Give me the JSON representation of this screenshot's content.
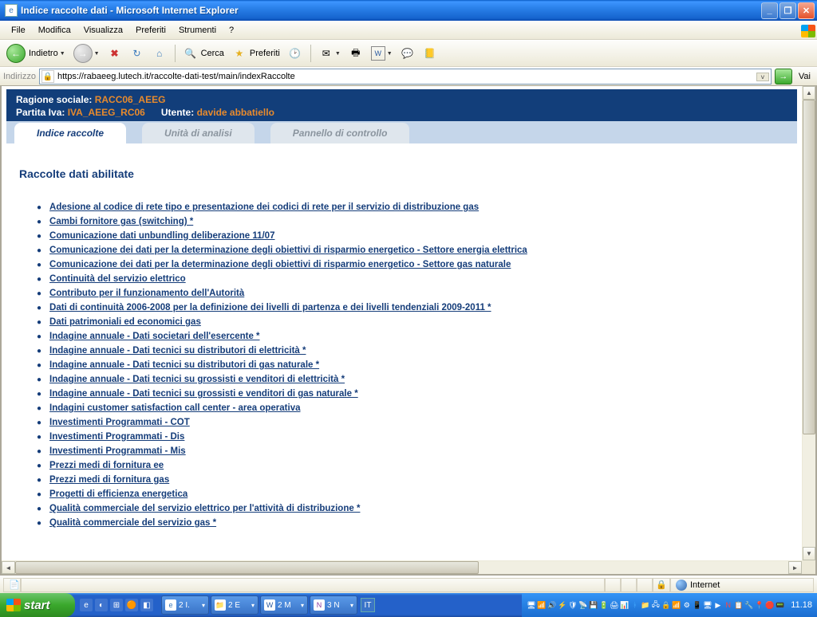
{
  "window": {
    "title": "Indice raccolte dati - Microsoft Internet Explorer"
  },
  "menu": [
    "File",
    "Modifica",
    "Visualizza",
    "Preferiti",
    "Strumenti",
    "?"
  ],
  "toolbar": {
    "back": "Indietro",
    "search": "Cerca",
    "favorites": "Preferiti"
  },
  "address": {
    "label": "Indirizzo",
    "url": "https://rabaeeg.lutech.it/raccolte-dati-test/main/indexRaccolte",
    "go": "Vai"
  },
  "header": {
    "ragione_label": "Ragione sociale:",
    "ragione_value": "RACC06_AEEG",
    "piva_label": "Partita Iva:",
    "piva_value": "IVA_AEEG_RC06",
    "utente_label": "Utente:",
    "utente_value": "davide abbatiello"
  },
  "tabs": [
    {
      "label": "Indice raccolte",
      "active": true
    },
    {
      "label": "Unità di analisi",
      "active": false
    },
    {
      "label": "Pannello di controllo",
      "active": false
    }
  ],
  "page": {
    "heading": "Raccolte dati abilitate",
    "links": [
      "Adesione al codice di rete tipo e presentazione dei codici di rete per il servizio di distribuzione gas",
      "Cambi fornitore gas (switching) *",
      "Comunicazione dati unbundling deliberazione 11/07",
      "Comunicazione dei dati per la determinazione degli obiettivi di risparmio energetico - Settore energia elettrica",
      "Comunicazione dei dati per la determinazione degli obiettivi di risparmio energetico - Settore gas naturale",
      "Continuità del servizio elettrico",
      "Contributo per il funzionamento dell'Autorità",
      "Dati di continuità 2006-2008 per la definizione dei livelli di partenza e dei livelli tendenziali 2009-2011 *",
      "Dati patrimoniali ed economici gas",
      "Indagine annuale - Dati societari dell'esercente *",
      "Indagine annuale - Dati tecnici su distributori di elettricità *",
      "Indagine annuale - Dati tecnici su distributori di gas naturale *",
      "Indagine annuale - Dati tecnici su grossisti e venditori di elettricità *",
      "Indagine annuale - Dati tecnici su grossisti e venditori di gas naturale *",
      "Indagini customer satisfaction call center - area operativa",
      "Investimenti Programmati - COT",
      "Investimenti Programmati - Dis",
      "Investimenti Programmati - Mis",
      "Prezzi medi di fornitura ee",
      "Prezzi medi di fornitura gas",
      "Progetti di efficienza energetica",
      "Qualità commerciale del servizio elettrico per l'attività di distribuzione *",
      "Qualità commerciale del servizio gas *"
    ]
  },
  "status": {
    "zone": "Internet"
  },
  "taskbar": {
    "start": "start",
    "tasks": [
      {
        "icon_text": "e",
        "icon_color": "#3a7abd",
        "label": "2 I."
      },
      {
        "icon_text": "📁",
        "icon_color": "#e6c760",
        "label": "2 E"
      },
      {
        "icon_text": "W",
        "icon_color": "#2a5aa0",
        "label": "2 M"
      },
      {
        "icon_text": "N",
        "icon_color": "#8a3aa0",
        "label": "3 N"
      }
    ],
    "lang": "IT",
    "clock": "11.18"
  }
}
